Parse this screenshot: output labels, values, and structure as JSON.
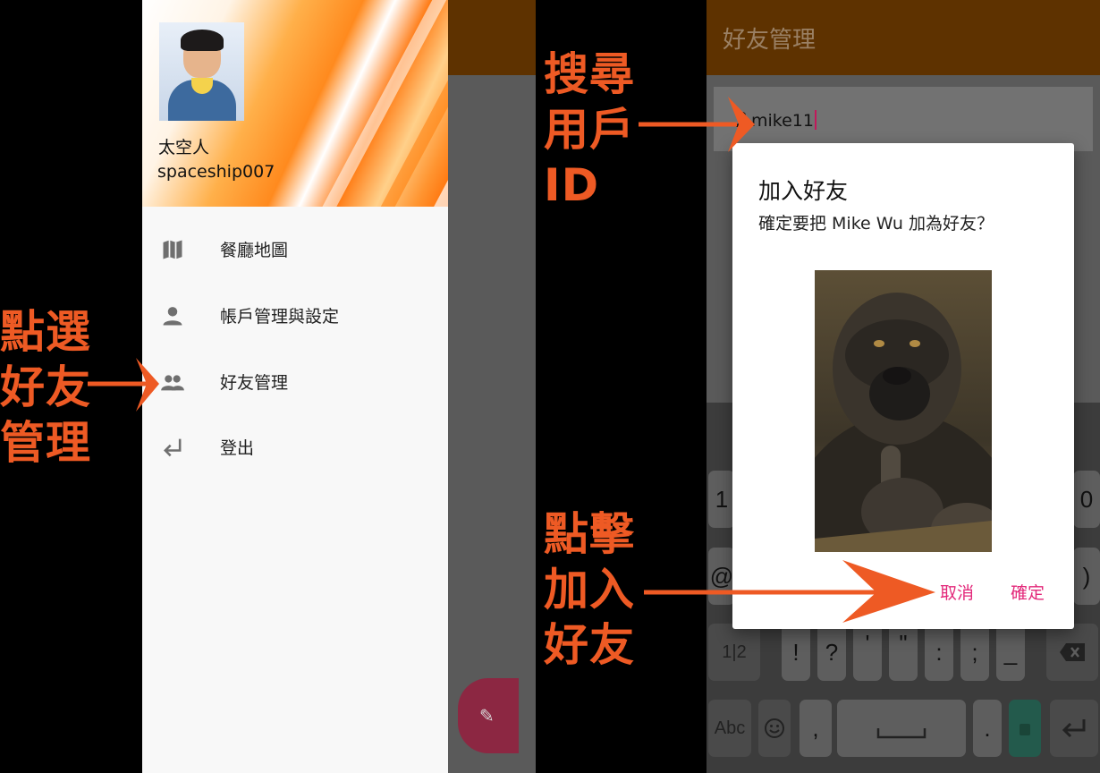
{
  "left_annotation": {
    "text": "點選\n好友\n管理"
  },
  "right_annotation_top": {
    "text": "搜尋\n用戶\nID"
  },
  "right_annotation_bottom": {
    "text": "點擊\n加入\n好友"
  },
  "drawer": {
    "profile": {
      "name": "太空人",
      "user_id": "spaceship007"
    },
    "items": [
      {
        "label": "餐廳地圖",
        "icon": "map-icon"
      },
      {
        "label": "帳戶管理與設定",
        "icon": "person-icon"
      },
      {
        "label": "好友管理",
        "icon": "people-icon"
      },
      {
        "label": "登出",
        "icon": "logout-arrow-icon"
      }
    ]
  },
  "friends_screen": {
    "title": "好友管理",
    "search_value": "mike11"
  },
  "dialog": {
    "title": "加入好友",
    "message": "確定要把 Mike Wu 加為好友？",
    "cancel_label": "取消",
    "confirm_label": "確定"
  },
  "keyboard": {
    "row1_left": "1",
    "row1_right": "0",
    "row2_left": "@",
    "row2_right": ")",
    "row3": [
      "1|2",
      "!",
      "?",
      "'",
      "\"",
      ":",
      ";",
      "_"
    ],
    "row4": [
      "Abc",
      ",",
      "."
    ]
  },
  "colors": {
    "accent": "#e3287a",
    "annotation": "#ee5a24",
    "app_bar": "#5e3200"
  }
}
